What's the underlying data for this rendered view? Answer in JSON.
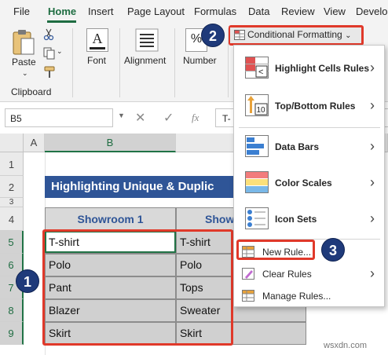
{
  "ribbon_tabs": [
    "File",
    "Home",
    "Insert",
    "Page Layout",
    "Formulas",
    "Data",
    "Review",
    "View",
    "Develo"
  ],
  "ribbon": {
    "paste_label": "Paste",
    "clipboard_label": "Clipboard",
    "font_label": "Font",
    "alignment_label": "Alignment",
    "number_label": "Number",
    "number_glyph": "%"
  },
  "formula_bar": {
    "name_box": "B5",
    "fx": "fx",
    "content": "T-"
  },
  "grid": {
    "col_headers": [
      "A",
      "B"
    ],
    "row_headers": [
      "1",
      "2",
      "3",
      "4",
      "5",
      "6",
      "7",
      "8",
      "9"
    ],
    "title": "Highlighting Unique & Duplic",
    "table_headers": [
      "Showroom 1",
      "Show"
    ],
    "rows": [
      [
        "T-shirt",
        "T-shirt"
      ],
      [
        "Polo",
        "Polo"
      ],
      [
        "Pant",
        "Tops"
      ],
      [
        "Blazer",
        "Sweater"
      ],
      [
        "Skirt",
        "Skirt"
      ]
    ]
  },
  "conditional_formatting": {
    "button_label": "Conditional Formatting",
    "caret": "⌄",
    "menu": [
      {
        "label": "Highlight Cells Rules",
        "icon": "highlight-cells-icon",
        "submenu": true
      },
      {
        "label": "Top/Bottom Rules",
        "icon": "top-bottom-icon",
        "submenu": true
      },
      {
        "label": "Data Bars",
        "icon": "data-bars-icon",
        "submenu": true
      },
      {
        "label": "Color Scales",
        "icon": "color-scales-icon",
        "submenu": true
      },
      {
        "label": "Icon Sets",
        "icon": "icon-sets-icon",
        "submenu": true
      },
      {
        "label": "New Rule...",
        "icon": "new-rule-icon",
        "submenu": false
      },
      {
        "label": "Clear Rules",
        "icon": "clear-rules-icon",
        "submenu": true
      },
      {
        "label": "Manage Rules...",
        "icon": "manage-rules-icon",
        "submenu": false
      }
    ],
    "top_bottom_badge": "10",
    "submenu_arrow": "›"
  },
  "callouts": [
    "1",
    "2",
    "3"
  ],
  "watermark": "wsxdn.com",
  "colors": {
    "excel_green": "#217346",
    "title_blue": "#2f5597",
    "highlight_red": "#e0392a",
    "badge_navy": "#1f3a7a"
  }
}
